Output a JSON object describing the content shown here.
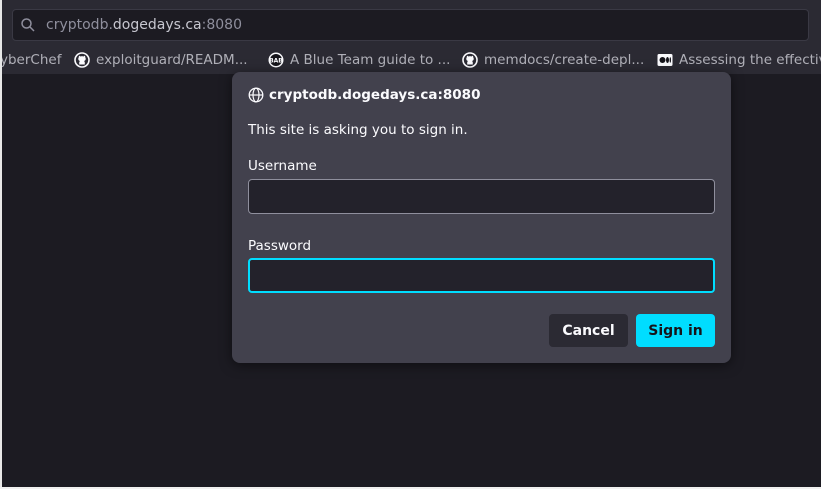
{
  "urlbar": {
    "url_subdomain": "cryptodb.",
    "url_host": "dogedays.ca",
    "url_port": ":8080",
    "icon": "search-icon"
  },
  "bookmarks": [
    {
      "label": "yberChef",
      "icon": ""
    },
    {
      "label": "exploitguard/READM...",
      "icon": "github-icon"
    },
    {
      "label": "A Blue Team guide to ...",
      "icon": "site-favicon"
    },
    {
      "label": "memdocs/create-depl...",
      "icon": "github-icon"
    },
    {
      "label": "Assessing the effectiv",
      "icon": "medium-icon"
    }
  ],
  "dialog": {
    "origin": "cryptodb.dogedays.ca:8080",
    "message": "This site is asking you to sign in.",
    "username_label": "Username",
    "username_value": "",
    "password_label": "Password",
    "password_value": "",
    "cancel_label": "Cancel",
    "signin_label": "Sign in"
  },
  "colors": {
    "accent": "#00ddff",
    "dialog_bg": "#42414d",
    "page_bg": "#1c1b22",
    "toolbar_bg": "#2b2a33"
  }
}
